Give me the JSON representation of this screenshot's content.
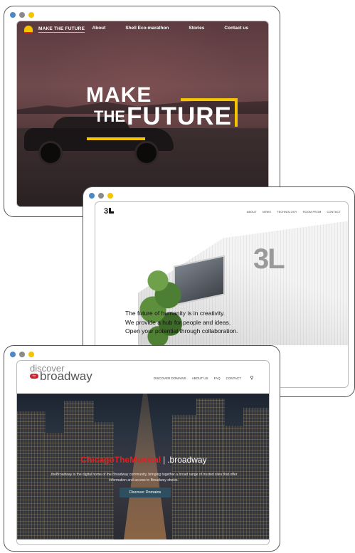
{
  "dots_colors": [
    "#4a88c7",
    "#8a8a8a",
    "#f5c400"
  ],
  "shell": {
    "brand": "MAKE THE FUTURE",
    "nav": [
      "About",
      "Shell Eco-marathon",
      "Stories",
      "Contact us"
    ],
    "hero": {
      "make": "MAKE",
      "the": "THE",
      "future": "FUTURE"
    },
    "accent": "#f5c400"
  },
  "threel": {
    "logo": "3",
    "nav": [
      "ABOUT",
      "NEWS",
      "TECHNOLOGY",
      "ROOM FROM",
      "CONTACT"
    ],
    "sign": "3L",
    "tagline": [
      "The future of humanity is in creativity.",
      "We provide a hub for people and ideas.",
      "Open your potential through collaboration."
    ]
  },
  "broadway": {
    "logo_top": "discover",
    "logo_pill": "the",
    "logo_bottom": "broadway",
    "nav": [
      "DISCOVER DOMAINS",
      "ABOUT US",
      "FAQ",
      "CONTACT"
    ],
    "title_red": "ChicagoTheMusical",
    "title_divider": "|",
    "title_white": ".broadway",
    "description": ".theBroadway is the digital home of the Broadway community, bringing together a broad range of trusted sites that offer information and access to Broadway shows.",
    "cta": "Discover Domains",
    "accent": "#d3212b"
  }
}
